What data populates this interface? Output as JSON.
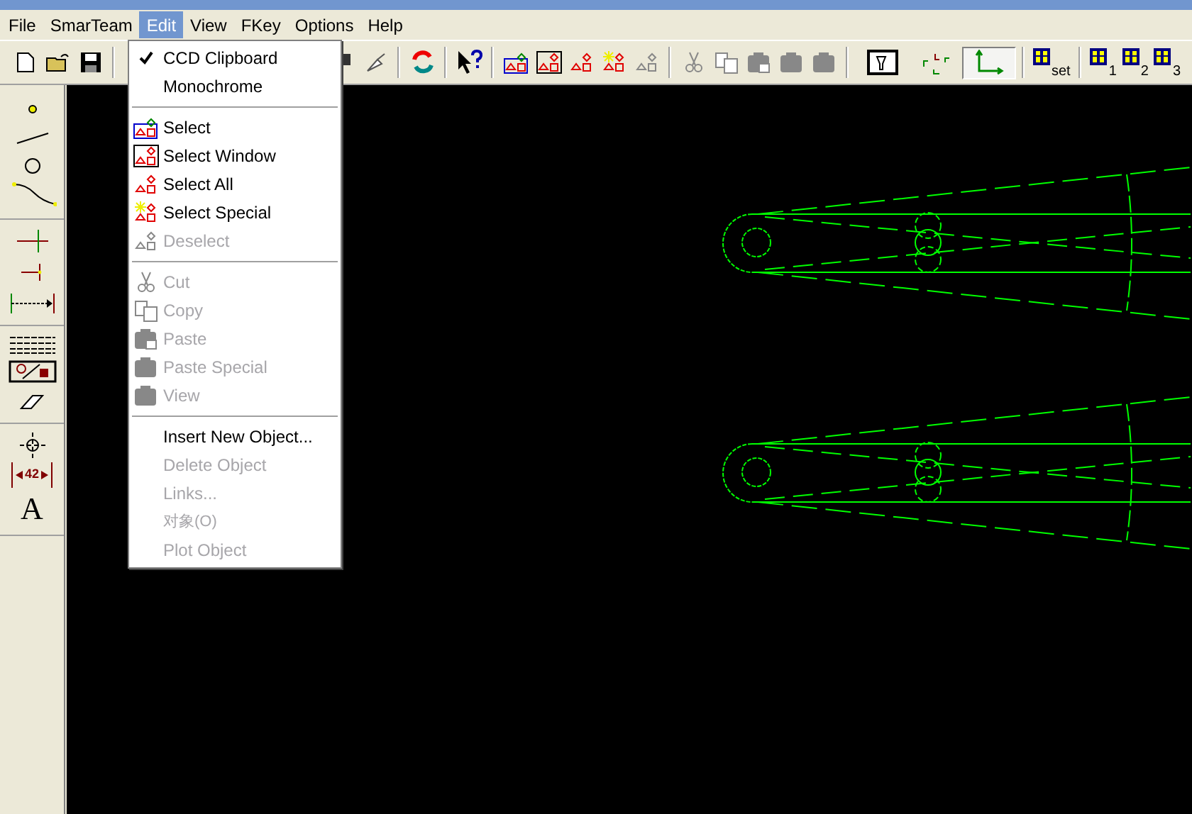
{
  "menubar": [
    {
      "label": "File",
      "selected": false
    },
    {
      "label": "SmarTeam",
      "selected": false
    },
    {
      "label": "Edit",
      "selected": true
    },
    {
      "label": "View",
      "selected": false
    },
    {
      "label": "FKey",
      "selected": false
    },
    {
      "label": "Options",
      "selected": false
    },
    {
      "label": "Help",
      "selected": false
    }
  ],
  "toolbar": {
    "view_buttons": [
      "set",
      "1",
      "2",
      "3"
    ],
    "axis_pressed": true
  },
  "left_toolbar": {
    "dimension_label": "42",
    "text_tool": "A"
  },
  "edit_menu": [
    {
      "kind": "item",
      "label": "CCD Clipboard",
      "checked": true,
      "disabled": false
    },
    {
      "kind": "item",
      "label": "Monochrome",
      "checked": false,
      "disabled": false
    },
    {
      "kind": "separator"
    },
    {
      "kind": "item",
      "label": "Select",
      "checked": false,
      "disabled": false
    },
    {
      "kind": "item",
      "label": "Select Window",
      "checked": false,
      "disabled": false
    },
    {
      "kind": "item",
      "label": "Select All",
      "checked": false,
      "disabled": false
    },
    {
      "kind": "item",
      "label": "Select Special",
      "checked": false,
      "disabled": false
    },
    {
      "kind": "item",
      "label": "Deselect",
      "checked": false,
      "disabled": true
    },
    {
      "kind": "separator"
    },
    {
      "kind": "item",
      "label": "Cut",
      "checked": false,
      "disabled": true
    },
    {
      "kind": "item",
      "label": "Copy",
      "checked": false,
      "disabled": true
    },
    {
      "kind": "item",
      "label": "Paste",
      "checked": false,
      "disabled": true
    },
    {
      "kind": "item",
      "label": "Paste Special",
      "checked": false,
      "disabled": true
    },
    {
      "kind": "item",
      "label": "View",
      "checked": false,
      "disabled": true
    },
    {
      "kind": "separator"
    },
    {
      "kind": "item",
      "label": "Insert New Object...",
      "checked": false,
      "disabled": false
    },
    {
      "kind": "item",
      "label": "Delete Object",
      "checked": false,
      "disabled": true
    },
    {
      "kind": "item",
      "label": "Links...",
      "checked": false,
      "disabled": true
    },
    {
      "kind": "item",
      "label": "对象(O)",
      "checked": false,
      "disabled": true
    },
    {
      "kind": "item",
      "label": "Plot Object",
      "checked": false,
      "disabled": true
    }
  ]
}
